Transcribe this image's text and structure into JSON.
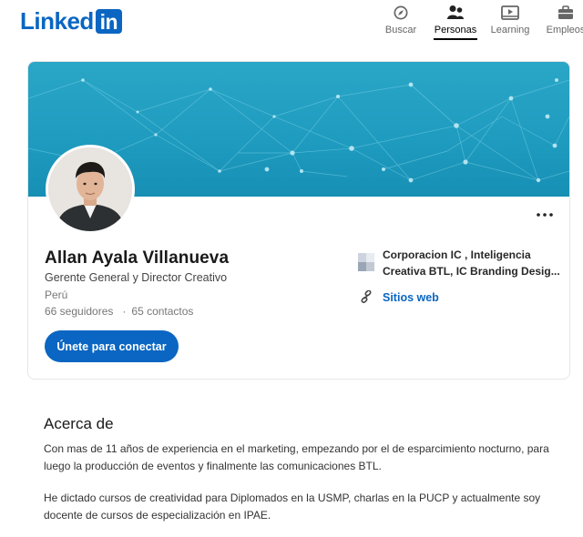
{
  "brand": {
    "logo_text": "Linked",
    "logo_box": "in",
    "color": "#0a66c2"
  },
  "nav": {
    "items": [
      {
        "label": "Buscar",
        "icon": "compass-icon"
      },
      {
        "label": "Personas",
        "icon": "people-icon",
        "active": true
      },
      {
        "label": "Learning",
        "icon": "video-icon"
      },
      {
        "label": "Empleos",
        "icon": "briefcase-icon"
      }
    ]
  },
  "profile": {
    "name": "Allan Ayala Villanueva",
    "headline": "Gerente General y Director Creativo",
    "location": "Perú",
    "followers": "66 seguidores",
    "separator": "·",
    "connections": "65 contactos",
    "connect_label": "Únete para conectar",
    "company_line1": "Corporacion IC , Inteligencia",
    "company_line2": "Creativa BTL, IC Branding Desig...",
    "website_label": "Sitios web",
    "more_icon": "more-horizontal-icon",
    "banner_color": "#1e9bbf"
  },
  "about": {
    "title": "Acerca de",
    "paragraph1": "Con mas de 11 años de experiencia en el marketing, empezando por el de esparcimiento nocturno, para luego la producción de eventos y finalmente las comunicaciones BTL.",
    "paragraph2": "He dictado cursos de creatividad para Diplomados en la USMP, charlas en la PUCP y actualmente soy docente de cursos de especialización en IPAE."
  }
}
